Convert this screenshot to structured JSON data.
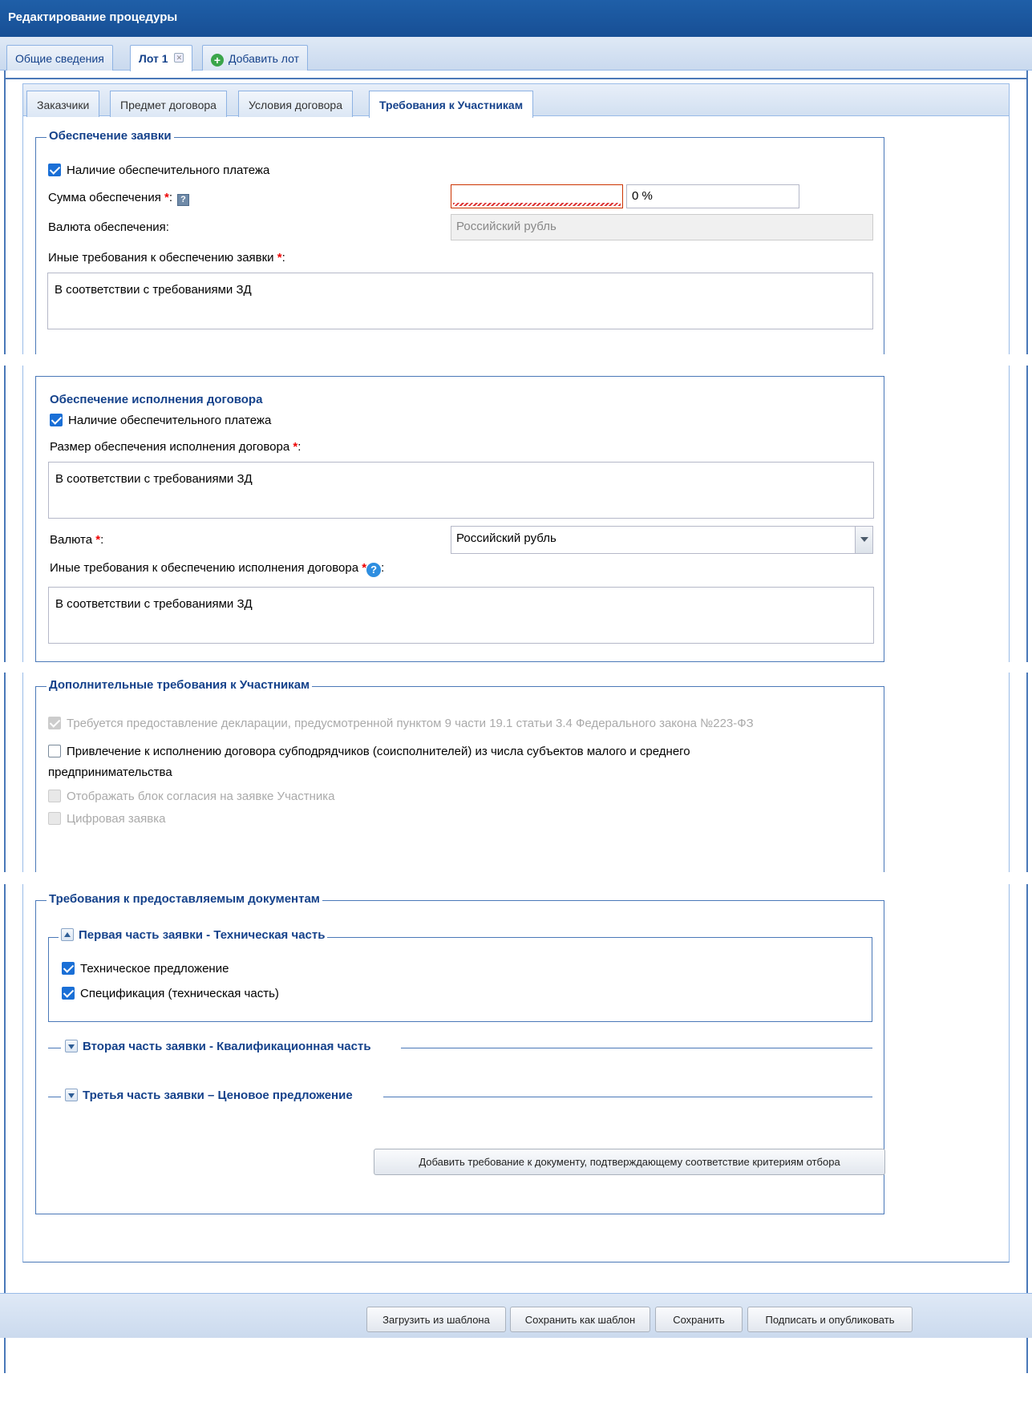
{
  "window": {
    "title": "Редактирование процедуры"
  },
  "top_tabs": [
    {
      "label": "Общие сведения"
    },
    {
      "label": "Лот 1"
    },
    {
      "label": "Добавить лот"
    }
  ],
  "sub_tabs": [
    {
      "label": "Заказчики"
    },
    {
      "label": "Предмет договора"
    },
    {
      "label": "Условия договора"
    },
    {
      "label": "Требования к Участникам"
    }
  ],
  "bid_security": {
    "legend": "Обеспечение заявки",
    "payment_checkbox": "Наличие обеспечительного платежа",
    "amount_label": "Сумма обеспечения",
    "amount_value": "",
    "percent_value": "0 %",
    "currency_label": "Валюта обеспечения:",
    "currency_value": "Российский рубль",
    "other_label": "Иные требования к обеспечению заявки",
    "other_value": "В соответствии с требованиями ЗД"
  },
  "contract_security": {
    "legend": "Обеспечение исполнения договора",
    "payment_checkbox": "Наличие обеспечительного платежа",
    "size_label": "Размер обеспечения исполнения договора",
    "size_value": "В соответствии с требованиями ЗД",
    "currency_label": "Валюта",
    "currency_value": "Российский рубль",
    "other_label": "Иные требования к обеспечению исполнения договора",
    "other_value": "В соответствии с требованиями ЗД"
  },
  "additional": {
    "legend": "Дополнительные требования к Участникам",
    "declaration": "Требуется предоставление декларации, предусмотренной пунктом 9 части 19.1 статьи 3.4 Федерального закона №223-ФЗ",
    "subcontractors_line1": "Привлечение к исполнению договора субподрядчиков (соисполнителей) из числа субъектов малого и среднего",
    "subcontractors_line2": "предпринимательства",
    "consent_block": "Отображать блок согласия на заявке Участника",
    "digital_bid": "Цифровая заявка"
  },
  "documents": {
    "legend": "Требования к предоставляемым документам",
    "part1": {
      "title": "Первая часть заявки - Техническая часть",
      "items": [
        "Техническое предложение",
        "Спецификация (техническая часть)"
      ]
    },
    "part2": {
      "title": "Вторая часть заявки - Квалификационная часть"
    },
    "part3": {
      "title": "Третья часть заявки – Ценовое предложение"
    },
    "add_button": "Добавить требование к документу, подтверждающему соответствие критериям отбора"
  },
  "footer_buttons": {
    "load_template": "Загрузить из шаблона",
    "save_template": "Сохранить как шаблон",
    "save": "Сохранить",
    "sign_publish": "Подписать и опубликовать"
  },
  "required_mark": "*",
  "colors": {
    "header": "#1f5fa8",
    "border": "#4a78b8",
    "legend": "#15428b",
    "required": "#ee0000",
    "check": "#1a6fd6"
  }
}
